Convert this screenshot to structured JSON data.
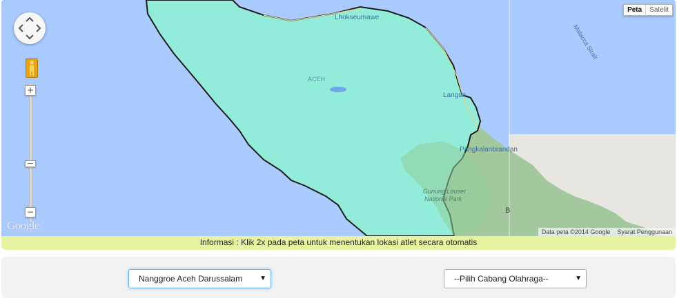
{
  "map": {
    "map_type_buttons": [
      "Peta",
      "Satelit"
    ],
    "active_map_type": "Peta",
    "place_labels": {
      "city_lhokseumawe": "Lhokseumawe",
      "region_aceh": "ACEH",
      "city_langsa": "Langsa",
      "city_pangkalanbrandan": "Pangkalanbrandan",
      "park_gunung_leuser": "Gunung Leuser",
      "park_national": "National Park",
      "partial_b": "B",
      "strait": "Malacca Strait"
    },
    "attribution": "Data peta ©2014 Google",
    "terms_link": "Syarat Penggunaan",
    "logo_text": "Google",
    "colors": {
      "water": "#aacbff",
      "aceh_region": "#93ecd9",
      "park_green": "#8fcf9a",
      "land_gray": "#e8e6e1",
      "border": "#1a1a1a"
    },
    "icons": {
      "pan": "pan-control-icon",
      "pegman": "pegman-icon",
      "zoom_in": "zoom-in-icon",
      "zoom_out": "zoom-out-icon"
    }
  },
  "info_bar": {
    "text": "Informasi : Klik 2x pada peta untuk menentukan lokasi atlet secara otomatis",
    "background": "#e7f3a0"
  },
  "form": {
    "province_select": {
      "selected": "Nanggroe Aceh Darussalam"
    },
    "cabang_select": {
      "selected": "--Pilih Cabang Olahraga--"
    }
  }
}
